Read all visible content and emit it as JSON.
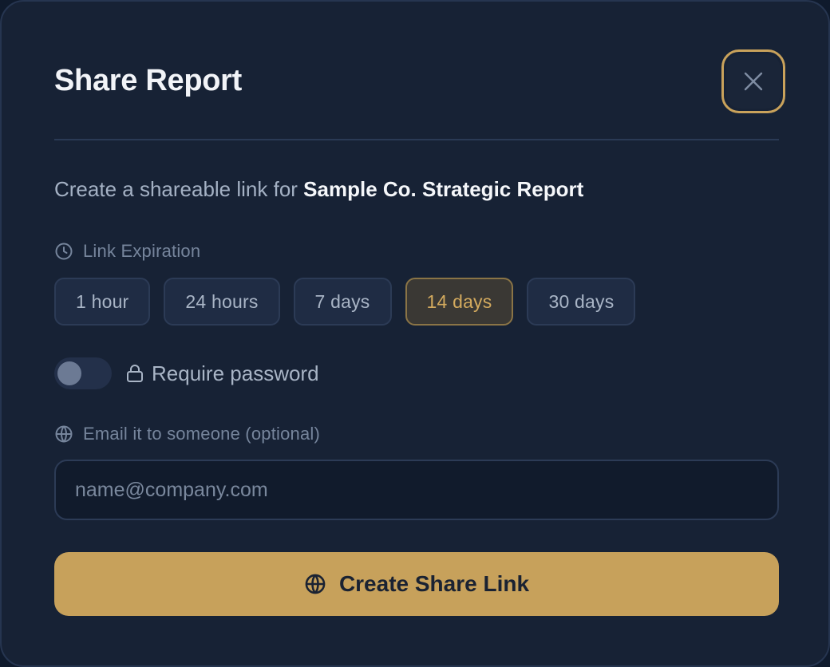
{
  "dialog": {
    "title": "Share Report",
    "close_icon": "close-icon"
  },
  "subtitle": {
    "prefix": "Create a shareable link for ",
    "report_name": "Sample Co. Strategic Report"
  },
  "expiration": {
    "label": "Link Expiration",
    "icon": "clock-icon",
    "options": [
      "1 hour",
      "24 hours",
      "7 days",
      "14 days",
      "30 days"
    ],
    "selected": "14 days"
  },
  "password": {
    "label": "Require password",
    "icon": "lock-icon",
    "enabled": false
  },
  "email": {
    "label": "Email it to someone (optional)",
    "icon": "globe-icon",
    "placeholder": "name@company.com",
    "value": ""
  },
  "submit": {
    "label": "Create Share Link",
    "icon": "globe-icon"
  },
  "colors": {
    "background": "#172235",
    "accent": "#c7a15b",
    "accent_text": "#d3aa5e"
  }
}
